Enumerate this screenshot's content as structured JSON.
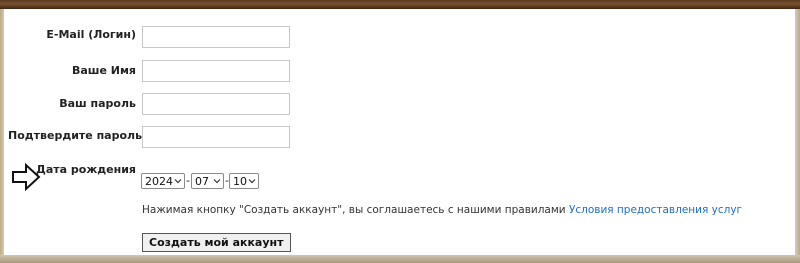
{
  "form": {
    "fields": [
      {
        "label": "E-Mail (Логин)",
        "value": ""
      },
      {
        "label": "Ваше Имя",
        "value": ""
      },
      {
        "label": "Ваш пароль",
        "value": ""
      },
      {
        "label": "Подтвердите пароль",
        "value": ""
      }
    ],
    "birthdate": {
      "label": "Дата рождения",
      "year": "2024",
      "month": "07",
      "day": "10",
      "separator": "-"
    },
    "notice": {
      "text": "Нажимая кнопку \"Создать аккаунт\", вы соглашаетесь с нашими правилами ",
      "link": "Условия предоставления услуг"
    },
    "submit_label": "Создать мой аккаунт"
  },
  "icons": {
    "arrow": "right-arrow-icon",
    "chevron": "chevron-down-icon"
  },
  "colors": {
    "frame_dark": "#5a3a1e",
    "link": "#1f6fbf",
    "background": "#ffffff"
  }
}
